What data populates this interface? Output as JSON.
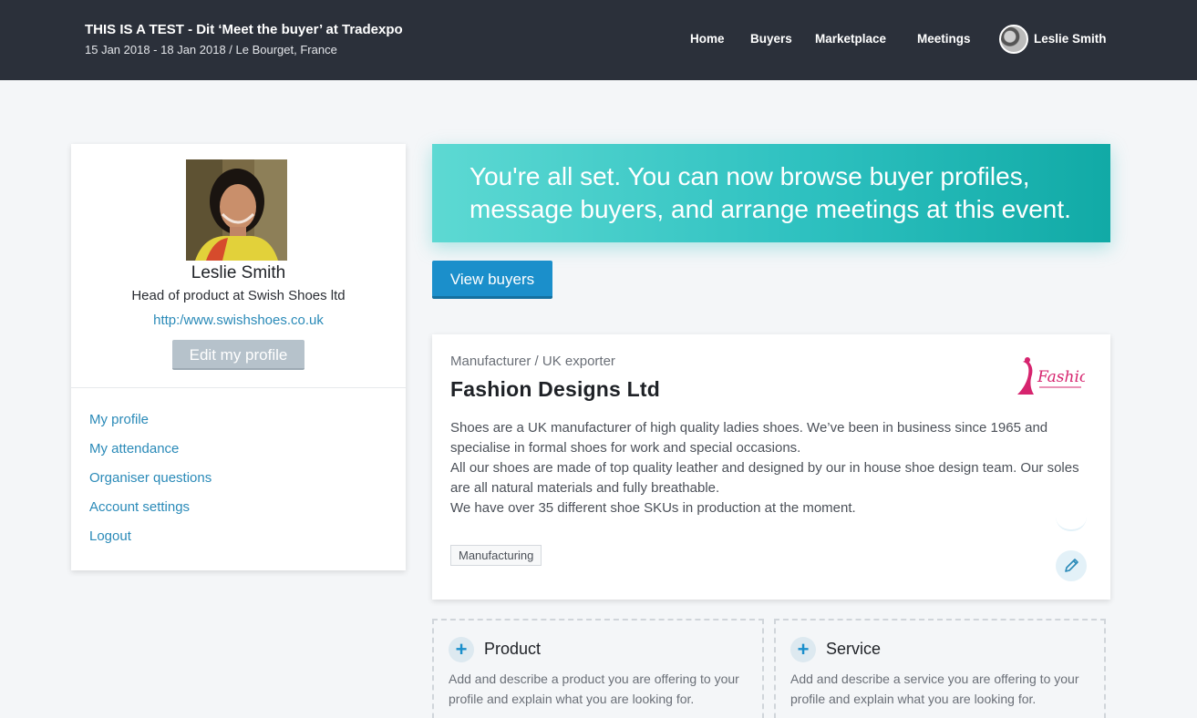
{
  "header": {
    "event_title": "THIS IS A TEST - Dit ‘Meet the buyer’ at Tradexpo",
    "event_subtitle": "15 Jan 2018 - 18 Jan 2018 / Le Bourget, France",
    "nav": [
      "Home",
      "Buyers",
      "Marketplace",
      "Meetings"
    ],
    "user_name": "Leslie Smith"
  },
  "profile": {
    "name": "Leslie Smith",
    "role": "Head of product at Swish Shoes ltd",
    "website": "http:/www.swishshoes.co.uk",
    "edit_label": "Edit my profile",
    "menu": [
      "My profile",
      "My attendance",
      "Organiser questions",
      "Account settings",
      "Logout"
    ]
  },
  "banner": {
    "text": "You're all set. You can now browse buyer profiles, message buyers, and arrange meetings at this event."
  },
  "view_buyers_label": "View buyers",
  "company": {
    "type": "Manufacturer / UK exporter",
    "name": "Fashion Designs Ltd",
    "logo_text": "Fashion",
    "description": [
      "Shoes are a UK manufacturer of high quality ladies shoes. We’ve been in business since 1965 and specialise in formal shoes for work and special occasions.",
      "All our shoes are made of top quality leather and designed by our in house shoe design team. Our soles are all natural materials and fully breathable.",
      "We have over 35 different shoe SKUs in production at the moment."
    ],
    "tag": "Manufacturing"
  },
  "add_product": {
    "title": "Product",
    "description": "Add and describe a product you are offering to your profile and explain what you are looking for."
  },
  "add_service": {
    "title": "Service",
    "description": "Add and describe a service you are offering to your profile and explain what you are looking for."
  },
  "colors": {
    "topbar": "#2b303a",
    "link": "#2a8ab8",
    "primary_button": "#1b8fcb",
    "banner_start": "#5dd9d3",
    "banner_end": "#11aaa6"
  }
}
